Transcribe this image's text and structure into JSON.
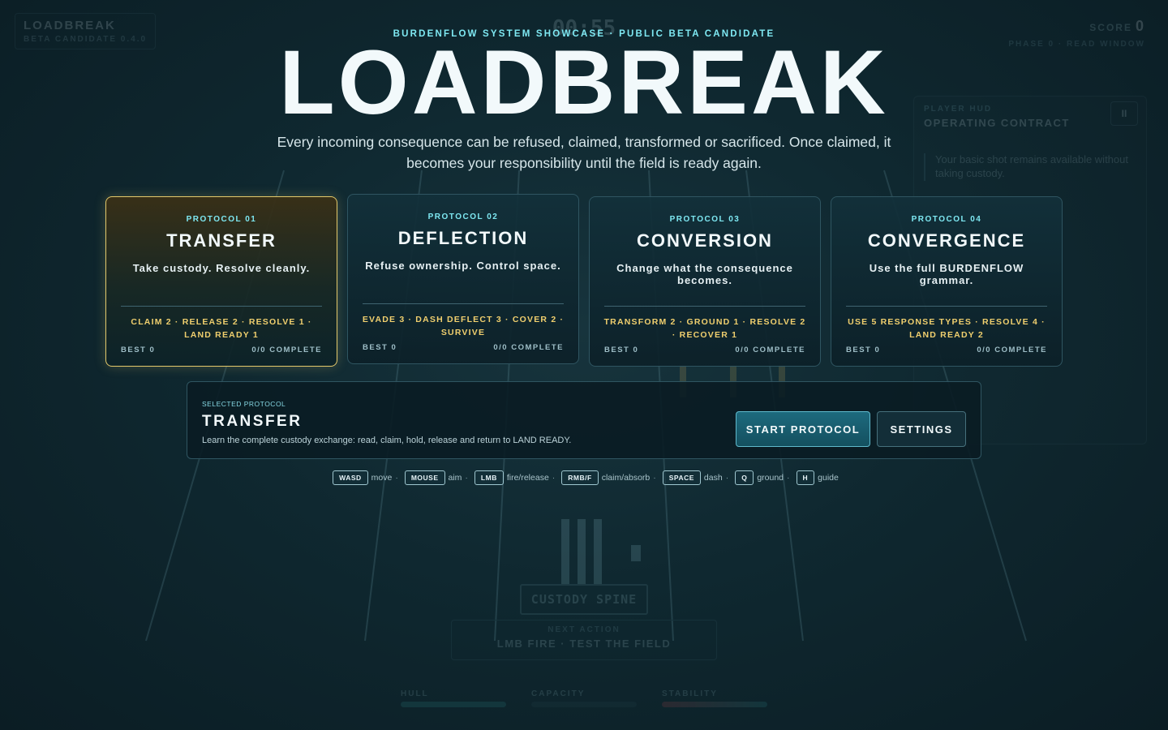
{
  "background_hud": {
    "game_name": "LOADBREAK",
    "build_label": "BETA CANDIDATE 0.4.0",
    "timer": "00:55",
    "score_label": "SCORE",
    "score_value": "0",
    "phase_label": "PHASE 0 · READ WINDOW",
    "panel_kicker": "PLAYER HUD",
    "panel_title": "OPERATING CONTRACT",
    "panel_text": "Your basic shot remains available without taking custody.",
    "pause_label": "II",
    "spine_label": "CUSTODY SPINE",
    "next_action_label": "NEXT ACTION",
    "next_action_value": "LMB FIRE · TEST THE FIELD",
    "bars": [
      {
        "label": "HULL",
        "level": 1.0
      },
      {
        "label": "CAPACITY",
        "level": 0.0
      },
      {
        "label": "STABILITY",
        "level": 1.0
      }
    ]
  },
  "header": {
    "kicker": "BURDENFLOW SYSTEM SHOWCASE · PUBLIC BETA CANDIDATE",
    "title": "LOADBREAK",
    "subtitle": "Every incoming consequence can be refused, claimed, transformed or sacrificed. Once claimed, it becomes your responsibility until the field is ready again."
  },
  "protocols": [
    {
      "kicker": "PROTOCOL 01",
      "name": "TRANSFER",
      "tagline": "Take custody. Resolve cleanly.",
      "goals": "CLAIM 2 · RELEASE 2 · RESOLVE 1 · LAND READY 1",
      "best": "BEST 0",
      "complete": "0/0 COMPLETE",
      "selected": true
    },
    {
      "kicker": "PROTOCOL 02",
      "name": "DEFLECTION",
      "tagline": "Refuse ownership. Control space.",
      "goals": "EVADE 3 · DASH DEFLECT 3 · COVER 2 · SURVIVE",
      "best": "BEST 0",
      "complete": "0/0 COMPLETE",
      "selected": false
    },
    {
      "kicker": "PROTOCOL 03",
      "name": "CONVERSION",
      "tagline": "Change what the consequence becomes.",
      "goals": "TRANSFORM 2 · GROUND 1 · RESOLVE 2 · RECOVER 1",
      "best": "BEST 0",
      "complete": "0/0 COMPLETE",
      "selected": false
    },
    {
      "kicker": "PROTOCOL 04",
      "name": "CONVERGENCE",
      "tagline": "Use the full BURDENFLOW grammar.",
      "goals": "USE 5 RESPONSE TYPES · RESOLVE 4 · LAND READY 2",
      "best": "BEST 0",
      "complete": "0/0 COMPLETE",
      "selected": false
    }
  ],
  "selected_panel": {
    "label": "SELECTED PROTOCOL",
    "name": "TRANSFER",
    "description": "Learn the complete custody exchange: read, claim, hold, release and return to LAND READY.",
    "start_label": "START PROTOCOL",
    "settings_label": "SETTINGS"
  },
  "controls": [
    {
      "key": "WASD",
      "action": "move"
    },
    {
      "key": "MOUSE",
      "action": "aim"
    },
    {
      "key": "LMB",
      "action": "fire/release"
    },
    {
      "key": "RMB/F",
      "action": "claim/absorb"
    },
    {
      "key": "SPACE",
      "action": "dash"
    },
    {
      "key": "Q",
      "action": "ground"
    },
    {
      "key": "H",
      "action": "guide"
    }
  ],
  "colors": {
    "accent_cyan": "#7ee8f2",
    "accent_gold": "#f0cf6e",
    "selected_border": "#e3c86a",
    "background": "#0f2830"
  }
}
